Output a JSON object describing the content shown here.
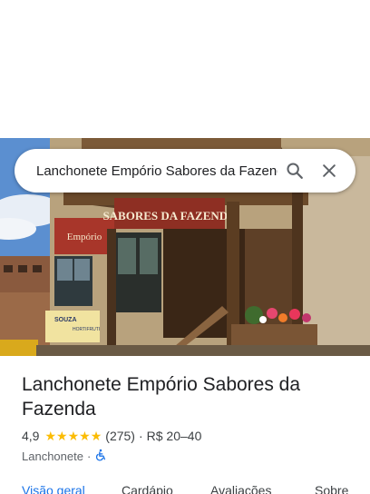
{
  "search": {
    "value": "Lanchonete Empório Sabores da Fazenda",
    "search_icon": "search-icon",
    "close_icon": "close-icon"
  },
  "photo": {
    "sign_text": "SABORES DA FAZENDA",
    "sign_logo_text": "Empório",
    "banner_left_text": "SOUZA",
    "banner_right_text": "HORTIFRUTI"
  },
  "place": {
    "title": "Lanchonete Empório Sabores da Fazenda",
    "rating": "4,9",
    "rating_value": 4.9,
    "review_count": "(275)",
    "price": "R$ 20–40",
    "separator": "·",
    "category": "Lanchonete",
    "accessibility_icon": "wheelchair-icon"
  },
  "tabs": [
    {
      "label": "Visão geral",
      "active": true
    },
    {
      "label": "Cardápio",
      "active": false
    },
    {
      "label": "Avaliações",
      "active": false
    },
    {
      "label": "Sobre",
      "active": false
    }
  ],
  "colors": {
    "star": "#fbbc04",
    "accent": "#1a73e8",
    "accessibility": "#1a73e8"
  }
}
